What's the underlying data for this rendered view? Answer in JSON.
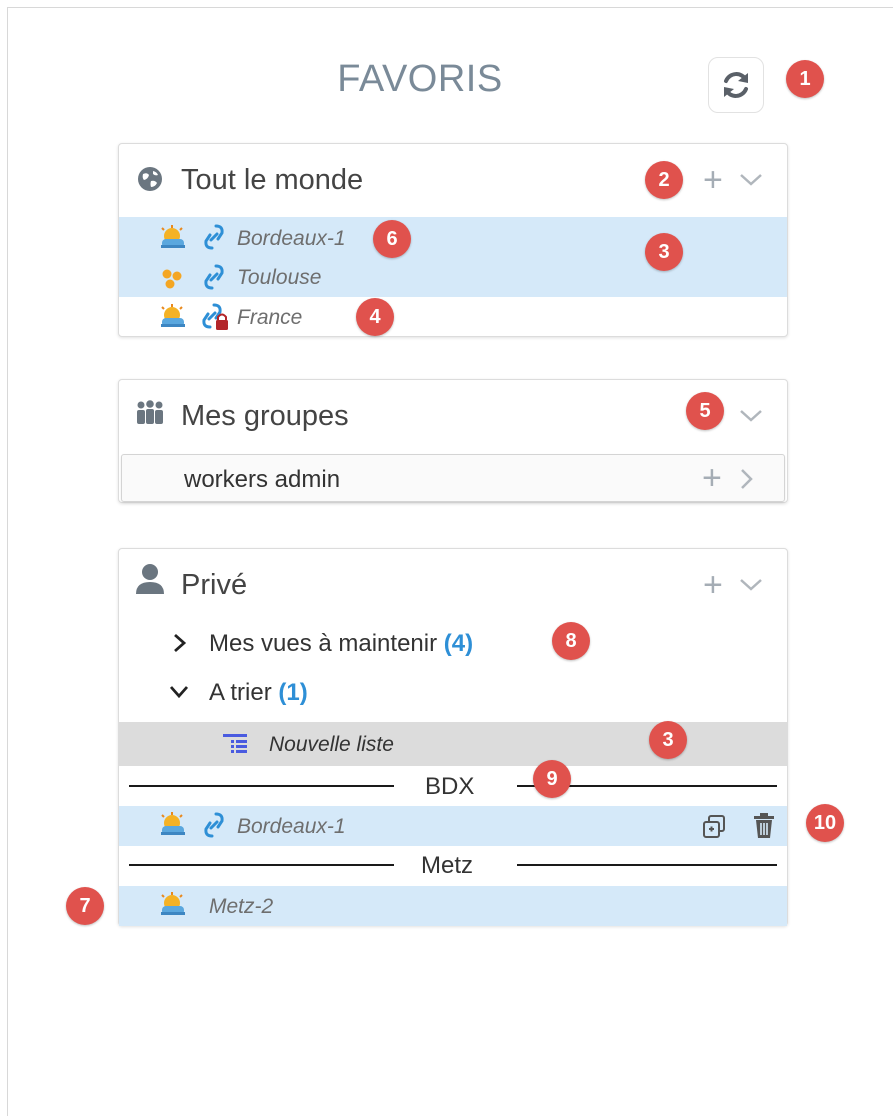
{
  "header": {
    "title": "FAVORIS"
  },
  "badges": {
    "b1": "1",
    "b2": "2",
    "b3a": "3",
    "b3b": "3",
    "b4": "4",
    "b5": "5",
    "b6": "6",
    "b7": "7",
    "b8": "8",
    "b9": "9",
    "b10": "10"
  },
  "public_panel": {
    "title": "Tout le monde",
    "items": [
      {
        "label": "Bordeaux-1"
      },
      {
        "label": "Toulouse"
      },
      {
        "label": "France"
      }
    ]
  },
  "groups_panel": {
    "title": "Mes groupes",
    "groups": [
      {
        "label": "workers admin"
      }
    ]
  },
  "private_panel": {
    "title": "Privé",
    "folders": [
      {
        "label": "Mes vues à maintenir",
        "count": "(4)",
        "expanded": false
      },
      {
        "label": "A trier",
        "count": "(1)",
        "expanded": true
      }
    ],
    "list_item": {
      "label": "Nouvelle liste"
    },
    "separators": [
      {
        "label": "BDX"
      },
      {
        "label": "Metz"
      }
    ],
    "items": [
      {
        "label": "Bordeaux-1"
      },
      {
        "label": "Metz-2"
      }
    ]
  },
  "colors": {
    "accent": "#2e8fd6",
    "badge": "#e0524d",
    "selected_row": "#d5e9f9",
    "grey_row": "#dcdcdc"
  }
}
